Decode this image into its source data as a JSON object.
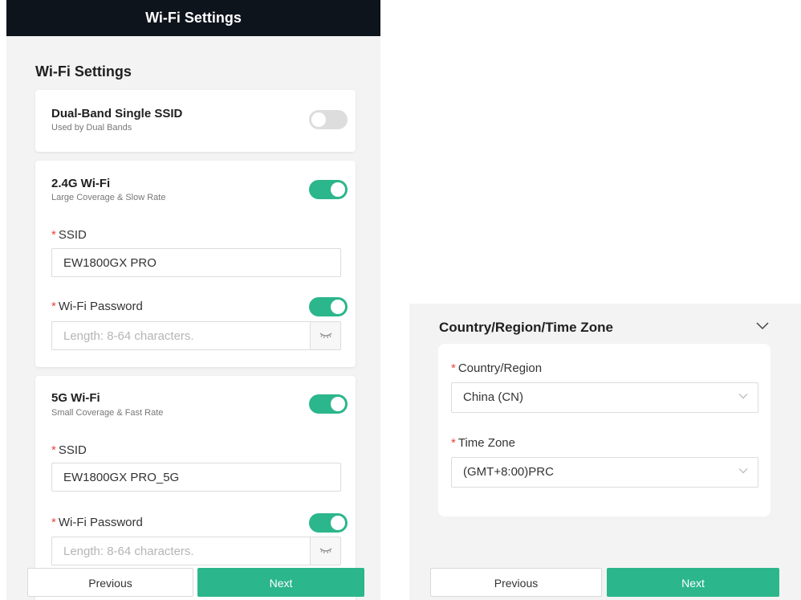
{
  "left": {
    "header_title": "Wi-Fi Settings",
    "section_title": "Wi-Fi Settings",
    "dual_band": {
      "title": "Dual-Band Single SSID",
      "subtitle": "Used by Dual Bands",
      "enabled": false
    },
    "wifi_24g": {
      "title": "2.4G Wi-Fi",
      "subtitle": "Large Coverage & Slow Rate",
      "enabled": true,
      "ssid_label": "SSID",
      "ssid_value": "EW1800GX PRO",
      "password_label": "Wi-Fi Password",
      "password_enabled": true,
      "password_placeholder": "Length: 8-64 characters."
    },
    "wifi_5g": {
      "title": "5G Wi-Fi",
      "subtitle": "Small Coverage & Fast Rate",
      "enabled": true,
      "ssid_label": "SSID",
      "ssid_value": "EW1800GX PRO_5G",
      "password_label": "Wi-Fi Password",
      "password_enabled": true,
      "password_placeholder": "Length: 8-64 characters."
    },
    "buttons": {
      "previous": "Previous",
      "next": "Next"
    }
  },
  "right": {
    "section_title": "Country/Region/Time Zone",
    "country_label": "Country/Region",
    "country_value": "China (CN)",
    "timezone_label": "Time Zone",
    "timezone_value": "(GMT+8:00)PRC",
    "buttons": {
      "previous": "Previous",
      "next": "Next"
    }
  },
  "required_marker": "*",
  "colors": {
    "accent": "#2bb68b",
    "header_bg": "#0e141b",
    "required": "#e9453e"
  },
  "icons": {
    "password_visibility": "eye-closed-icon",
    "section_collapse": "chevron-down-icon",
    "select_arrow": "chevron-down-icon"
  }
}
